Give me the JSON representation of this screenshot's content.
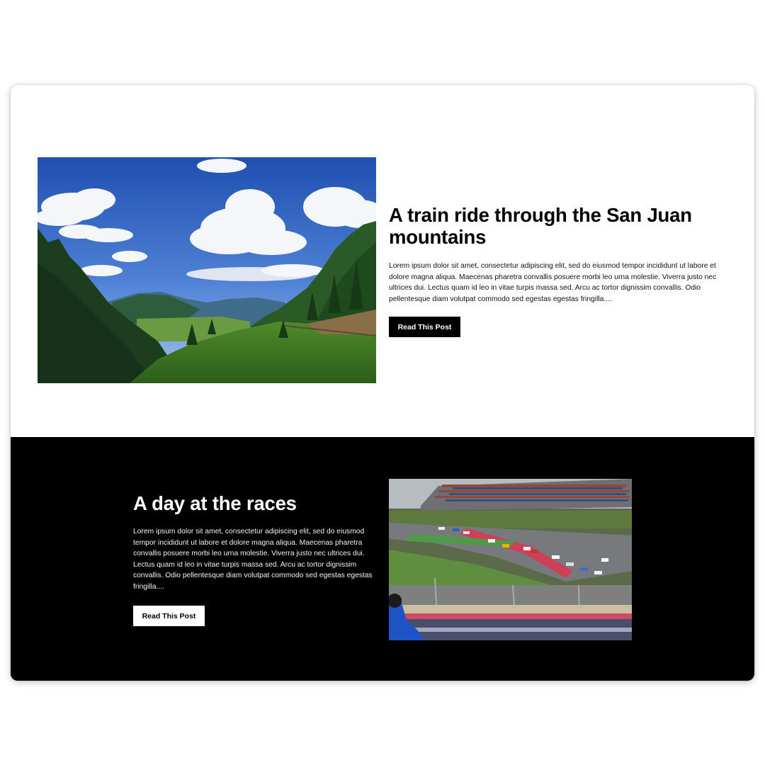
{
  "posts": [
    {
      "title": "A train ride through the San Juan mountains",
      "excerpt": "Lorem ipsum dolor sit amet, consectetur adipiscing elit, sed do eiusmod tempor incididunt ut labore et dolore magna aliqua. Maecenas pharetra convallis posuere morbi leo urna molestie. Viverra justo nec ultrices dui. Lectus quam id leo in vitae turpis massa sed. Arcu ac tortor dignissim convallis. Odio pellentesque diam volutpat commodo sed egestas egestas fringilla....",
      "button_label": "Read This Post",
      "image_icon": "mountain-landscape-photo",
      "theme": "light"
    },
    {
      "title": "A day at the races",
      "excerpt": "Lorem ipsum dolor sit amet, consectetur adipiscing elit, sed do eiusmod tempor incididunt ut labore et dolore magna aliqua. Maecenas pharetra convallis posuere morbi leo urna molestie. Viverra justo nec ultrices dui. Lectus quam id leo in vitae turpis massa sed. Arcu ac tortor dignissim convallis. Odio pellentesque diam volutpat commodo sed egestas egestas fringilla....",
      "button_label": "Read This Post",
      "image_icon": "race-track-photo",
      "theme": "dark"
    }
  ],
  "colors": {
    "light_bg": "#ffffff",
    "dark_bg": "#000000",
    "light_button_bg": "#000000",
    "dark_button_bg": "#ffffff"
  }
}
